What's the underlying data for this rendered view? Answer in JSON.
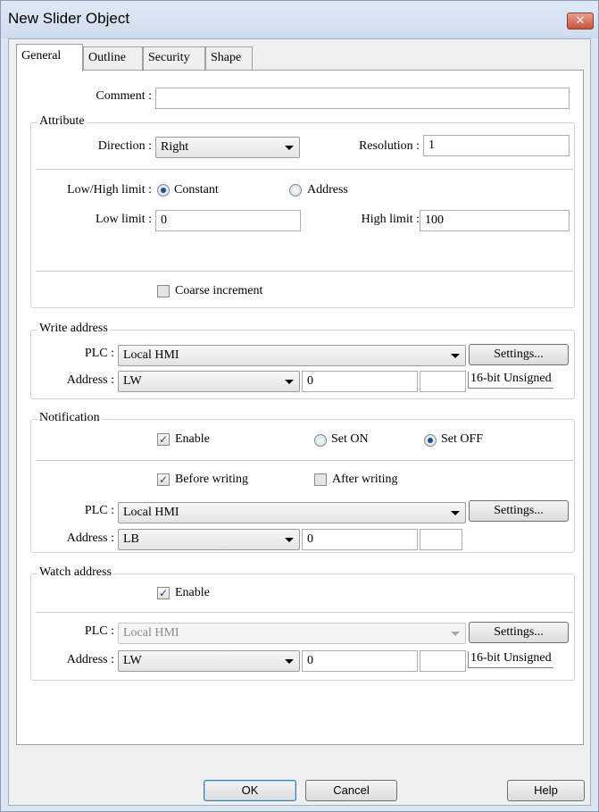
{
  "window": {
    "title": "New Slider Object",
    "close_icon": "close-icon"
  },
  "tabs": [
    {
      "label": "General",
      "active": true
    },
    {
      "label": "Outline",
      "active": false
    },
    {
      "label": "Security",
      "active": false
    },
    {
      "label": "Shape",
      "active": false
    }
  ],
  "comment": {
    "label": "Comment :",
    "value": ""
  },
  "attribute": {
    "title": "Attribute",
    "direction_label": "Direction :",
    "direction_value": "Right",
    "resolution_label": "Resolution :",
    "resolution_value": "1",
    "lowhigh_label": "Low/High limit :",
    "constant_label": "Constant",
    "constant_selected": true,
    "address_label": "Address",
    "address_selected": false,
    "low_label": "Low limit :",
    "low_value": "0",
    "high_label": "High limit :",
    "high_value": "100",
    "coarse_label": "Coarse increment",
    "coarse_checked": false
  },
  "write_address": {
    "title": "Write address",
    "plc_label": "PLC :",
    "plc_value": "Local HMI",
    "settings_label": "Settings...",
    "address_label": "Address :",
    "device_value": "LW",
    "address_value": "0",
    "extra_value": "",
    "data_type": "16-bit Unsigned"
  },
  "notification": {
    "title": "Notification",
    "enable_label": "Enable",
    "enable_checked": true,
    "set_on_label": "Set ON",
    "set_on_selected": false,
    "set_off_label": "Set OFF",
    "set_off_selected": true,
    "before_label": "Before writing",
    "before_checked": true,
    "after_label": "After writing",
    "after_checked": false,
    "plc_label": "PLC :",
    "plc_value": "Local HMI",
    "settings_label": "Settings...",
    "address_label": "Address :",
    "device_value": "LB",
    "address_value": "0",
    "extra_value": ""
  },
  "watch_address": {
    "title": "Watch address",
    "enable_label": "Enable",
    "enable_checked": true,
    "plc_label": "PLC :",
    "plc_value": "Local HMI",
    "settings_label": "Settings...",
    "address_label": "Address :",
    "device_value": "LW",
    "address_value": "0",
    "extra_value": "",
    "data_type": "16-bit Unsigned"
  },
  "footer": {
    "ok_label": "OK",
    "cancel_label": "Cancel",
    "help_label": "Help"
  }
}
